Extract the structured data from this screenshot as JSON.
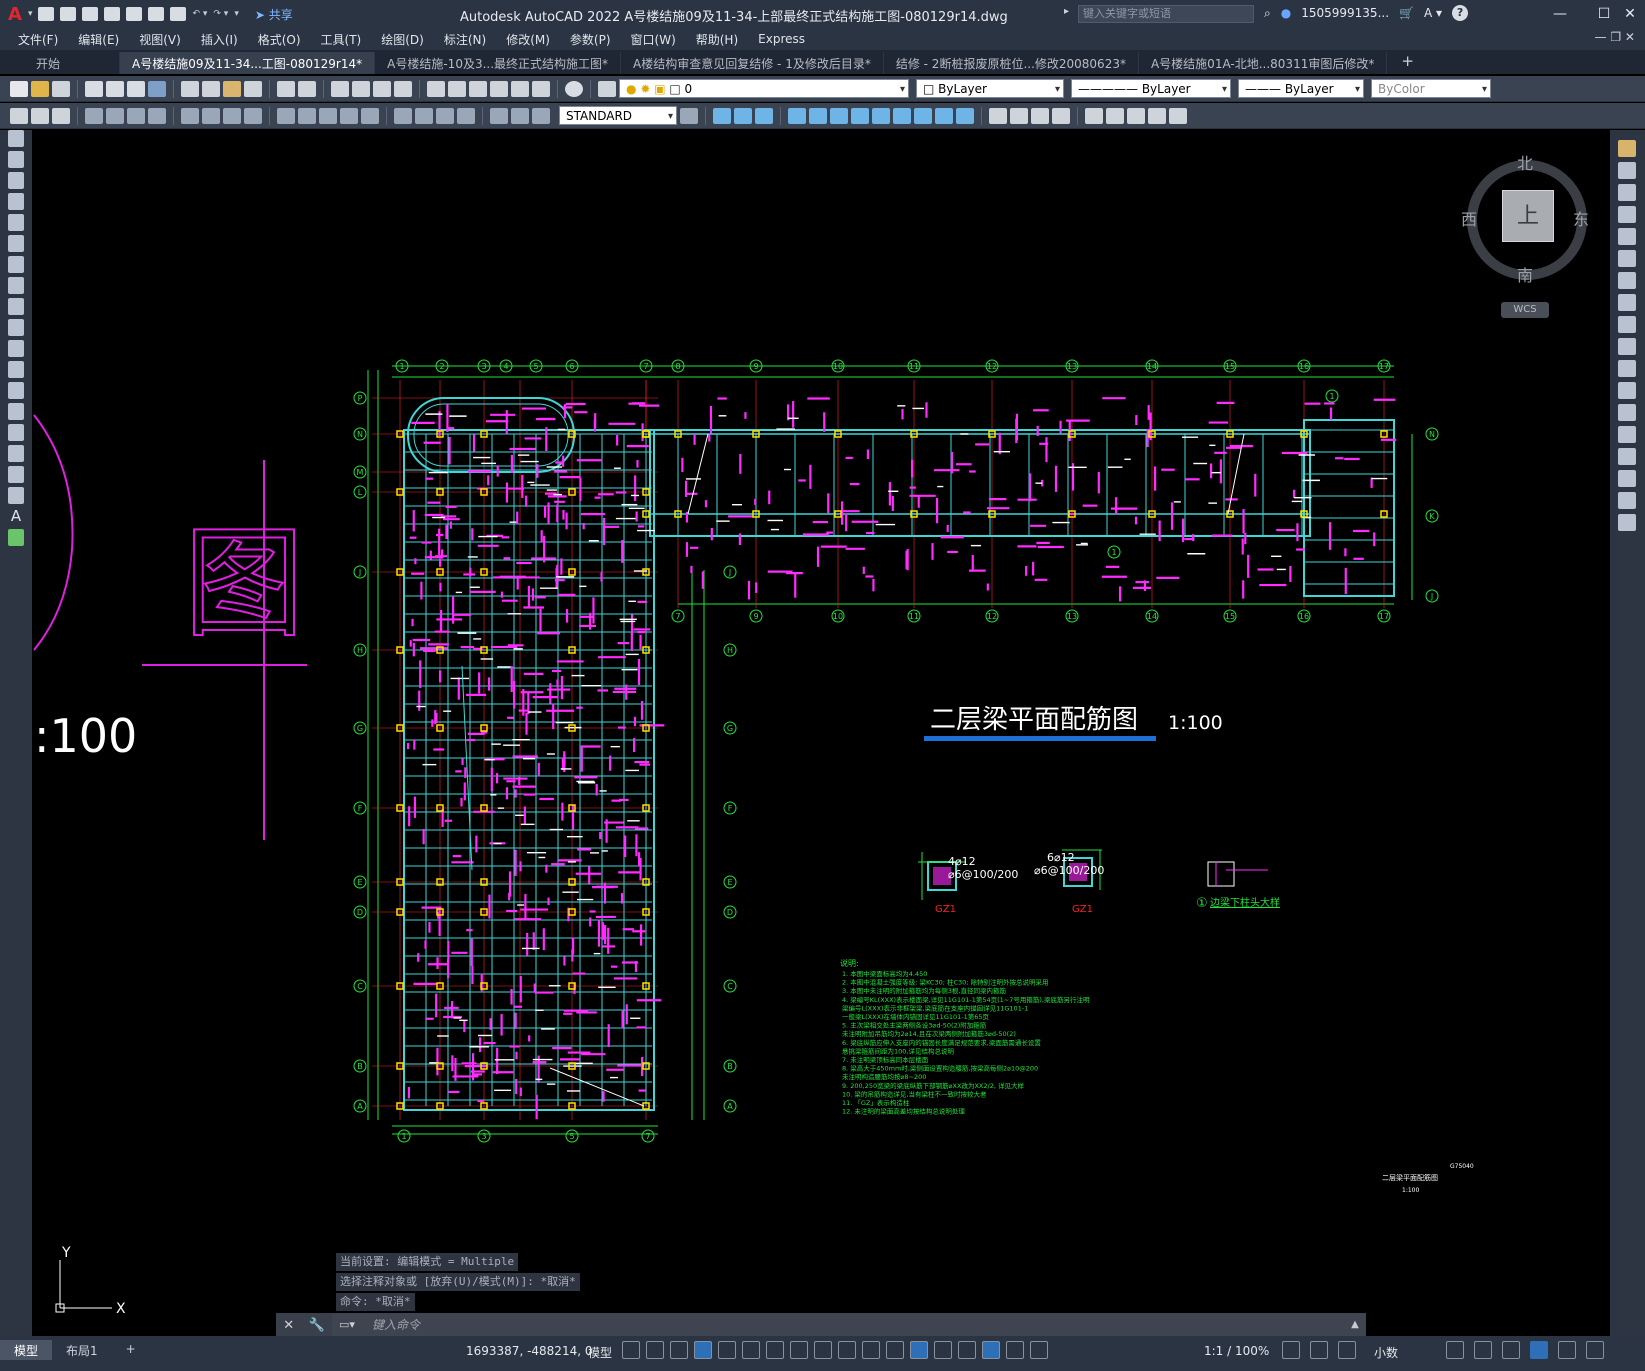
{
  "app": {
    "title": "Autodesk AutoCAD 2022    A号楼结施09及11-34-上部最终正式结构施工图-080129r14.dwg",
    "share_label": "共享",
    "search_placeholder": "键入关键字或短语",
    "user": "1505999135...",
    "help": "?"
  },
  "menu": [
    "文件(F)",
    "编辑(E)",
    "视图(V)",
    "插入(I)",
    "格式(O)",
    "工具(T)",
    "绘图(D)",
    "标注(N)",
    "修改(M)",
    "参数(P)",
    "窗口(W)",
    "帮助(H)",
    "Express"
  ],
  "tabs": [
    {
      "label": "开始",
      "active": false
    },
    {
      "label": "A号楼结施09及11-34...工图-080129r14*",
      "active": true
    },
    {
      "label": "A号楼结施-10及3...最终正式结构施工图*",
      "active": false
    },
    {
      "label": "A楼结构审查意见回复结修 - 1及修改后目录*",
      "active": false
    },
    {
      "label": "结修 - 2断桩报废原桩位...修改20080623*",
      "active": false
    },
    {
      "label": "A号楼结施01A-北地...80311审图后修改*",
      "active": false
    }
  ],
  "properties": {
    "layer_value": "0",
    "color": "ByLayer",
    "linetype": "ByLayer",
    "lineweight": "ByLayer",
    "plotstyle": "ByColor",
    "text_style": "STANDARD"
  },
  "drawing": {
    "title": "二层梁平面配筋图",
    "scale": "1:100",
    "partial_scale": ":100",
    "partial_char": "图",
    "detail_label": "边梁下柱头大样",
    "detail_num": "①",
    "gz1_a": "GZ1",
    "gz1_b": "GZ1",
    "gz1_a_spec": "4⌀12",
    "gz1_a_hoop": "⌀6@100/200",
    "gz1_b_spec": "6⌀12",
    "gz1_b_hoop": "⌀6@100/200",
    "notes_title": "说明:",
    "note_lines": [
      "1. 本图中梁面标高均为4.450",
      "2. 本图中混凝土强度等级: 梁KC30; 柱C30; 除特别注明外按总说明采用",
      "3. 本图中未注明的附加箍筋均为每侧3根,直径同梁内箍筋",
      "4. 梁编号KL(XXX)表示楼面梁,详见11G101-1第54页(1~7号用箍筋),梁底筋另行注明",
      "   梁编号L(XXX)表示非框架梁,梁底筋在支座内锚固详见11G101-1",
      "   一般梁L(XXX)在墙体内锚固详见11G101-1第65页",
      "5. 主次梁相交处主梁两侧各设3⌀d-50(2)附加箍筋",
      "   未注明附加吊筋均为2⌀14,且在次梁两侧附加箍筋3⌀d-50(2)",
      "6. 梁底纵筋应伸入支座内的锚固长度满足规范要求,梁面筋需通长设置",
      "   悬挑梁箍筋间距为100,详见结构总说明",
      "7. 未注明梁顶标高同本层楼面",
      "8. 梁高大于450mm时,梁侧面设置构造腰筋,按梁高每侧2⌀10@200",
      "   未注明构造腰筋均按⌀8~200",
      "9. 200,250宽梁的梁底纵筋下部钢筋⌀XX改为XX2/2, 详见大样",
      "10. 梁的吊筋构造详见,当有梁柱不一致时按较大者",
      "11. 「GZ」表示构造柱",
      "12. 未注明的梁面高差均按结构总说明处理"
    ],
    "titleblock": "二层梁平面配筋图",
    "titleblock_scale": "1:100",
    "sheet_code": "G75040",
    "compass": {
      "north": "北",
      "south": "南",
      "east": "东",
      "west": "西",
      "top": "上",
      "wcs": "WCS"
    },
    "ucs_x": "X",
    "ucs_y": "Y"
  },
  "grid": {
    "top_numbers": [
      "1",
      "2",
      "3",
      "4",
      "5",
      "6",
      "7",
      "8",
      "9",
      "10",
      "11",
      "12",
      "13",
      "14",
      "15",
      "16",
      "17"
    ],
    "left_letters": [
      "P",
      "N",
      "M",
      "L",
      "J",
      "H",
      "G",
      "F",
      "E",
      "D",
      "C",
      "B",
      "A"
    ],
    "right_east_letters": [
      "N",
      "K",
      "J"
    ],
    "bottom_west_numbers": [
      "1",
      "3",
      "5",
      "7"
    ],
    "bottom_east_numbers": [
      "7",
      "9",
      "10",
      "11",
      "12",
      "13",
      "14",
      "15",
      "16",
      "17"
    ]
  },
  "command": {
    "history": [
      "当前设置: 编辑模式 = Multiple",
      "选择注释对象或 [放弃(U)/模式(M)]: *取消*",
      "命令: *取消*"
    ],
    "placeholder": "键入命令"
  },
  "status": {
    "layout_tabs": [
      "模型",
      "布局1"
    ],
    "coords": "1693387, -488214, 0",
    "model": "模型",
    "scale": "1:1 / 100%",
    "units": "小数"
  },
  "colors": {
    "grid_line": "#22e33a",
    "beam": "#3fd6d6",
    "rebar_text": "#ff2bff",
    "axis_red": "#ff2020",
    "column": "#ffe000",
    "title_underline": "#1f6fd6"
  }
}
